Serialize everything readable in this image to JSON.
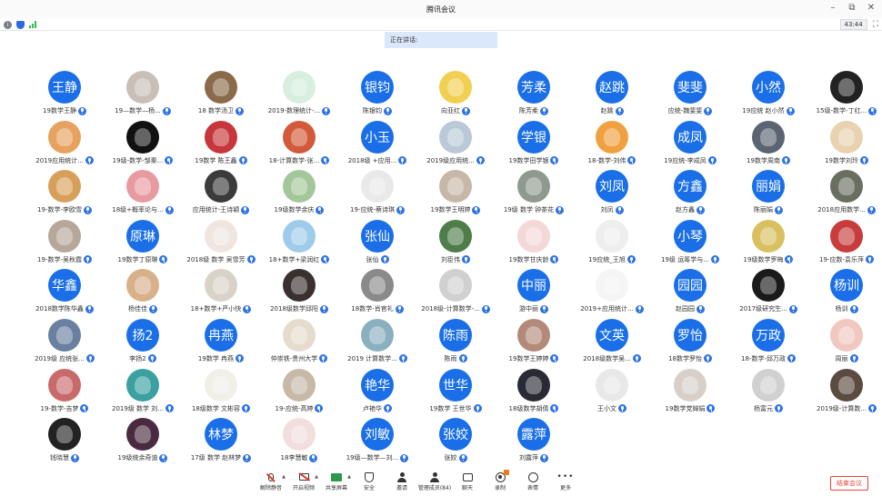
{
  "window": {
    "title": "腾讯会议",
    "controls": [
      "–",
      "⧉",
      "✕"
    ]
  },
  "status": {
    "info_glyph": "i",
    "time": "43:44",
    "fullscreen_glyph": "⛶"
  },
  "banner": {
    "speaking_label": "正在讲话:"
  },
  "accent": "#1a6fe8",
  "participants": [
    {
      "avatar_text": "王静",
      "name": "19数学王静",
      "avatar_color": "#1a6fe8"
    },
    {
      "avatar_text": "",
      "name": "19—数学—杨...",
      "avatar_color": "#c9bfb6"
    },
    {
      "avatar_text": "",
      "name": "18 数学汤卫",
      "avatar_color": "#8a6a4a"
    },
    {
      "avatar_text": "",
      "name": "2019-数理统计-...",
      "avatar_color": "#d8eede"
    },
    {
      "avatar_text": "银钧",
      "name": "陈银钧",
      "avatar_color": "#1a6fe8"
    },
    {
      "avatar_text": "",
      "name": "向亚红",
      "avatar_color": "#f1cf50"
    },
    {
      "avatar_text": "芳柔",
      "name": "陈芳柔",
      "avatar_color": "#1a6fe8"
    },
    {
      "avatar_text": "赵跳",
      "name": "赵跳",
      "avatar_color": "#1a6fe8"
    },
    {
      "avatar_text": "斐斐",
      "name": "应统-魏斐斐",
      "avatar_color": "#1a6fe8"
    },
    {
      "avatar_text": "小然",
      "name": "19应统 赵小然",
      "avatar_color": "#1a6fe8"
    },
    {
      "avatar_text": "",
      "name": "15级-数学-丁红...",
      "avatar_color": "#222222"
    },
    {
      "avatar_text": "",
      "name": "2019应用统计...",
      "avatar_color": "#e6a25e"
    },
    {
      "avatar_text": "",
      "name": "19级-数学-邹秦...",
      "avatar_color": "#111111"
    },
    {
      "avatar_text": "",
      "name": "19数学 陈王鑫",
      "avatar_color": "#c7363a"
    },
    {
      "avatar_text": "",
      "name": "18-计算数学-张...",
      "avatar_color": "#d25a3a"
    },
    {
      "avatar_text": "小玉",
      "name": "2018级 +应用...",
      "avatar_color": "#1a6fe8"
    },
    {
      "avatar_text": "",
      "name": "2019级应用统...",
      "avatar_color": "#b9c9d8"
    },
    {
      "avatar_text": "学银",
      "name": "19数学田学银",
      "avatar_color": "#1a6fe8"
    },
    {
      "avatar_text": "",
      "name": "18-数学-刘伟",
      "avatar_color": "#f0a040"
    },
    {
      "avatar_text": "成凤",
      "name": "19应统-李成凤",
      "avatar_color": "#1a6fe8"
    },
    {
      "avatar_text": "",
      "name": "19数学周南",
      "avatar_color": "#5a6472"
    },
    {
      "avatar_text": "",
      "name": "19数学刘玲",
      "avatar_color": "#e8d2b0"
    },
    {
      "avatar_text": "",
      "name": "19-数学-李欧雪",
      "avatar_color": "#d7a05a"
    },
    {
      "avatar_text": "",
      "name": "18级+概率论与...",
      "avatar_color": "#e89aa0"
    },
    {
      "avatar_text": "",
      "name": "应用统计-王诗颖",
      "avatar_color": "#3b3b3b"
    },
    {
      "avatar_text": "",
      "name": "19级数学余庆",
      "avatar_color": "#a4c79a"
    },
    {
      "avatar_text": "",
      "name": "19-应统-蔡诗琪",
      "avatar_color": "#e9e9e9"
    },
    {
      "avatar_text": "",
      "name": "19数学王明婷",
      "avatar_color": "#c7b7a8"
    },
    {
      "avatar_text": "",
      "name": "19级 数学 钟茶花",
      "avatar_color": "#8e9a8e"
    },
    {
      "avatar_text": "刘凤",
      "name": "刘凤",
      "avatar_color": "#1a6fe8"
    },
    {
      "avatar_text": "方鑫",
      "name": "赵方鑫",
      "avatar_color": "#1a6fe8"
    },
    {
      "avatar_text": "丽娟",
      "name": "陈丽娟",
      "avatar_color": "#1a6fe8"
    },
    {
      "avatar_text": "",
      "name": "2018应用数学...",
      "avatar_color": "#6a6e60"
    },
    {
      "avatar_text": "",
      "name": "19-数学-吴秋霞",
      "avatar_color": "#b5a79a"
    },
    {
      "avatar_text": "原琳",
      "name": "19数学丁原琳",
      "avatar_color": "#1a6fe8"
    },
    {
      "avatar_text": "",
      "name": "2018级 数学 吴雪芳",
      "avatar_color": "#f0e6e0"
    },
    {
      "avatar_text": "",
      "name": "18+数学+梁润红",
      "avatar_color": "#9ecbea"
    },
    {
      "avatar_text": "张仙",
      "name": "张仙",
      "avatar_color": "#1a6fe8"
    },
    {
      "avatar_text": "",
      "name": "刘臣伟",
      "avatar_color": "#4f7d4a"
    },
    {
      "avatar_text": "",
      "name": "19数学甘庆龄",
      "avatar_color": "#f4d8d8"
    },
    {
      "avatar_text": "",
      "name": "19应统_王旭",
      "avatar_color": "#eeeeee"
    },
    {
      "avatar_text": "小琴",
      "name": "19级 运筹学与...",
      "avatar_color": "#1a6fe8"
    },
    {
      "avatar_text": "",
      "name": "19级数学罗梅",
      "avatar_color": "#d8c060"
    },
    {
      "avatar_text": "",
      "name": "19-应数-袁乐萍",
      "avatar_color": "#c83c3c"
    },
    {
      "avatar_text": "华鑫",
      "name": "2018数学陈华鑫",
      "avatar_color": "#1a6fe8"
    },
    {
      "avatar_text": "",
      "name": "杨佳佳",
      "avatar_color": "#d8b08a"
    },
    {
      "avatar_text": "",
      "name": "18+数学+严小快",
      "avatar_color": "#d9d2c8"
    },
    {
      "avatar_text": "",
      "name": "2018级数学邱阳",
      "avatar_color": "#3a3030"
    },
    {
      "avatar_text": "",
      "name": "18数学-肖官礼",
      "avatar_color": "#8a8a8a"
    },
    {
      "avatar_text": "",
      "name": "2018级-计算数学-...",
      "avatar_color": "#d0d0d0"
    },
    {
      "avatar_text": "中丽",
      "name": "游中丽",
      "avatar_color": "#1a6fe8"
    },
    {
      "avatar_text": "",
      "name": "2019+应用统计...",
      "avatar_color": "#f5f5f5"
    },
    {
      "avatar_text": "园园",
      "name": "赵园园",
      "avatar_color": "#1a6fe8"
    },
    {
      "avatar_text": "",
      "name": "2017级研究生...",
      "avatar_color": "#1a1a1a"
    },
    {
      "avatar_text": "杨训",
      "name": "杨训",
      "avatar_color": "#1a6fe8"
    },
    {
      "avatar_text": "",
      "name": "2019级 应统张...",
      "avatar_color": "#6a80a0"
    },
    {
      "avatar_text": "扬2",
      "name": "李扬2",
      "avatar_color": "#1a6fe8"
    },
    {
      "avatar_text": "冉燕",
      "name": "19数学 冉燕",
      "avatar_color": "#1a6fe8"
    },
    {
      "avatar_text": "",
      "name": "仲崇铁-贵州大学",
      "avatar_color": "#e6dccd"
    },
    {
      "avatar_text": "",
      "name": "2019 计算数学...",
      "avatar_color": "#8ab0c0"
    },
    {
      "avatar_text": "陈雨",
      "name": "陈雨",
      "avatar_color": "#1a6fe8"
    },
    {
      "avatar_text": "",
      "name": "19数学王婷婷",
      "avatar_color": "#b38a7a"
    },
    {
      "avatar_text": "文英",
      "name": "2018级数学吴...",
      "avatar_color": "#1a6fe8"
    },
    {
      "avatar_text": "罗怡",
      "name": "18数学罗怡",
      "avatar_color": "#1a6fe8"
    },
    {
      "avatar_text": "万政",
      "name": "18-数学-邱万政",
      "avatar_color": "#1a6fe8"
    },
    {
      "avatar_text": "",
      "name": "周丽",
      "avatar_color": "#f0c8c0"
    },
    {
      "avatar_text": "",
      "name": "19-数学-吉梦",
      "avatar_color": "#c96a6a"
    },
    {
      "avatar_text": "",
      "name": "2019级 数学 刘...",
      "avatar_color": "#3aa0a0"
    },
    {
      "avatar_text": "",
      "name": "18级数学 文彬容",
      "avatar_color": "#f0efe8"
    },
    {
      "avatar_text": "",
      "name": "19-应统-高婷",
      "avatar_color": "#c7b8a8"
    },
    {
      "avatar_text": "艳华",
      "name": "卢艳华",
      "avatar_color": "#1a6fe8"
    },
    {
      "avatar_text": "世华",
      "name": "19数学 王世华",
      "avatar_color": "#1a6fe8"
    },
    {
      "avatar_text": "",
      "name": "18级数学胡倩",
      "avatar_color": "#2a2a35"
    },
    {
      "avatar_text": "",
      "name": "王小文",
      "avatar_color": "#e8e8e8"
    },
    {
      "avatar_text": "",
      "name": "19数学党婵娟",
      "avatar_color": "#d8d0c8"
    },
    {
      "avatar_text": "",
      "name": "杨富元",
      "avatar_color": "#d0d0d0"
    },
    {
      "avatar_text": "",
      "name": "2019级-计算数...",
      "avatar_color": "#5a4a40"
    },
    {
      "avatar_text": "",
      "name": "钱晓慧",
      "avatar_color": "#222222"
    },
    {
      "avatar_text": "",
      "name": "19级统余奇迪",
      "avatar_color": "#4a2a40"
    },
    {
      "avatar_text": "林梦",
      "name": "17级 数学 赵林梦",
      "avatar_color": "#1a6fe8"
    },
    {
      "avatar_text": "",
      "name": "18李慧敏",
      "avatar_color": "#f2dede"
    },
    {
      "avatar_text": "刘敏",
      "name": "19级—数学—刘...",
      "avatar_color": "#1a6fe8"
    },
    {
      "avatar_text": "张姣",
      "name": "张姣",
      "avatar_color": "#1a6fe8"
    },
    {
      "avatar_text": "露萍",
      "name": "刘露萍",
      "avatar_color": "#1a6fe8"
    }
  ],
  "toolbar": {
    "unmute": "解除静音",
    "start_video": "开启视频",
    "share_screen": "共享屏幕",
    "security": "安全",
    "invite": "邀请",
    "manage_members": "管理成员(84)",
    "chat": "聊天",
    "record": "录制",
    "reaction": "表情",
    "more": "更多",
    "more_glyph": "•••",
    "caret": "▲"
  },
  "end_meeting": "结束会议"
}
